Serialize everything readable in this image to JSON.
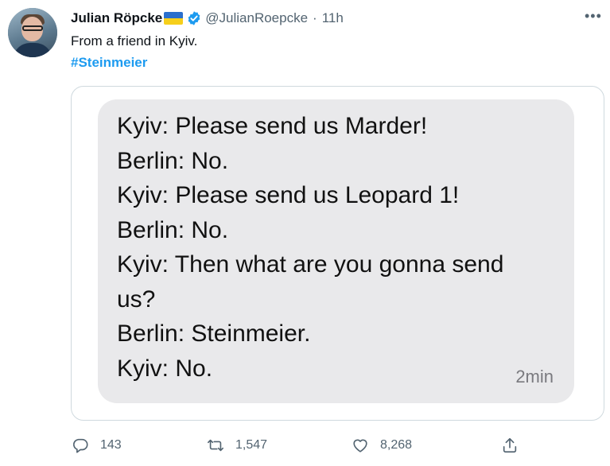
{
  "tweet": {
    "author_name": "Julian Röpcke",
    "handle": "@JulianRoepcke",
    "separator": "·",
    "time": "11h",
    "more_label": "•••",
    "text": "From a friend in Kyiv.",
    "hashtag": "#Steinmeier"
  },
  "chat": {
    "lines": [
      "Kyiv: Please send us Marder!",
      "Berlin: No.",
      "Kyiv: Please send us Leopard 1!",
      "Berlin: No.",
      "Kyiv: Then what are you gonna send",
      "us?",
      "Berlin: Steinmeier.",
      "Kyiv: No."
    ],
    "timestamp": "2min"
  },
  "actions": {
    "replies": "143",
    "retweets": "1,547",
    "likes": "8,268"
  },
  "icons": {
    "verified": "verified-badge-icon",
    "flag": "ukraine-flag-icon",
    "reply": "reply-icon",
    "retweet": "retweet-icon",
    "like": "heart-icon",
    "share": "share-icon"
  },
  "colors": {
    "accent": "#1d9bf0",
    "muted": "#536471",
    "bubble": "#e9e9eb"
  }
}
